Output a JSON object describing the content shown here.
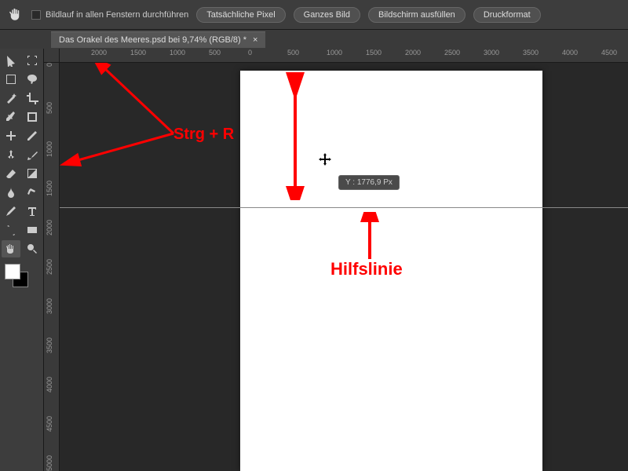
{
  "toolbar": {
    "scroll_all_label": "Bildlauf in allen Fenstern durchführen",
    "buttons": {
      "actual_pixels": "Tatsächliche Pixel",
      "fit_screen": "Ganzes Bild",
      "fill_screen": "Bildschirm ausfüllen",
      "print_size": "Druckformat"
    }
  },
  "tab": {
    "title": "Das Orakel des Meeres.psd bei 9,74% (RGB/8) *",
    "close": "×"
  },
  "ruler_h": {
    "ticks": [
      "0",
      "2000",
      "1500",
      "1000",
      "500",
      "0",
      "500",
      "1000",
      "1500",
      "2000",
      "2500",
      "3000",
      "3500",
      "4000",
      "4500"
    ]
  },
  "ruler_v": {
    "ticks": [
      "0",
      "500",
      "1000",
      "1500",
      "2000",
      "2500",
      "3000",
      "3500",
      "4000",
      "4500",
      "5000"
    ]
  },
  "tooltip": {
    "label": "Y :",
    "value": "1776,9 Px"
  },
  "annotations": {
    "rulers": "Strg + R",
    "guide": "Hilfslinie"
  },
  "tools": {
    "names": [
      "move",
      "artboard",
      "marquee",
      "lasso",
      "wand",
      "crop",
      "eyedropper",
      "frame",
      "healing",
      "brush",
      "clone",
      "history",
      "eraser",
      "gradient",
      "blur",
      "dodge",
      "pen",
      "type",
      "path",
      "shape",
      "hand",
      "zoom"
    ]
  }
}
